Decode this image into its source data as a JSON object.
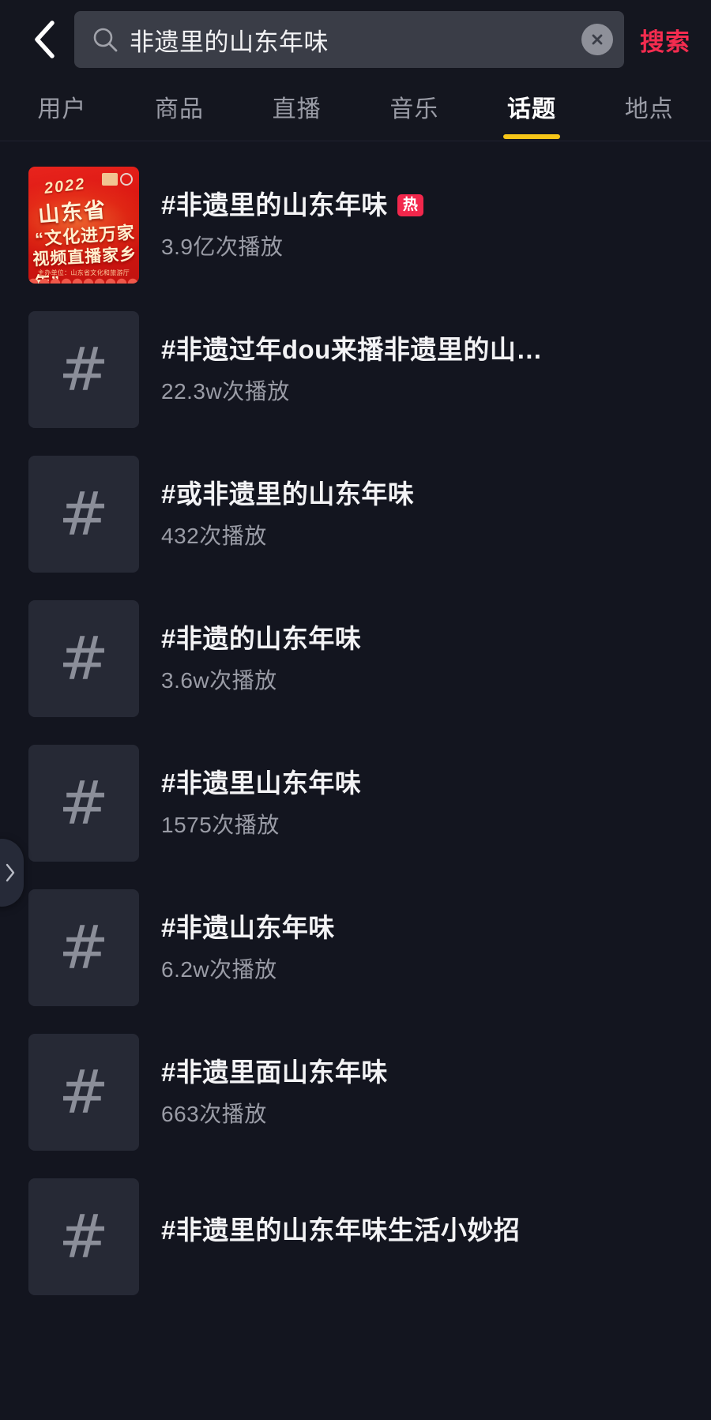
{
  "theme": {
    "background": "#13151f",
    "accent_red": "#f42c4f",
    "accent_yellow": "#f5c518",
    "badge_red": "#f2274c",
    "text_primary": "#f3f3f5",
    "text_secondary": "#9a9ca6",
    "thumb_bg": "#262935"
  },
  "header": {
    "back_icon": "chevron-left-icon",
    "search": {
      "icon": "search-icon",
      "value": "非遗里的山东年味",
      "placeholder": "搜索",
      "clear_icon": "close-circle-icon"
    },
    "submit_label": "搜索"
  },
  "tabs": {
    "active_index": 4,
    "items": [
      {
        "label": "用户"
      },
      {
        "label": "商品"
      },
      {
        "label": "直播"
      },
      {
        "label": "音乐"
      },
      {
        "label": "话题"
      },
      {
        "label": "地点"
      }
    ]
  },
  "poster": {
    "year": "2022",
    "line1": "山东省",
    "line2": "“文化进万家",
    "line3": "视频直播家乡年”",
    "footer": "主办单位：山东省文化和旅游厅"
  },
  "results": [
    {
      "thumb_type": "poster",
      "title": "#非遗里的山东年味",
      "badge": "热",
      "plays": "3.9亿次播放"
    },
    {
      "thumb_type": "hash",
      "thumb_glyph": "#",
      "title": "#非遗过年dou来播非遗里的山…",
      "badge": "",
      "plays": "22.3w次播放"
    },
    {
      "thumb_type": "hash",
      "thumb_glyph": "#",
      "title": "#或非遗里的山东年味",
      "badge": "",
      "plays": "432次播放"
    },
    {
      "thumb_type": "hash",
      "thumb_glyph": "#",
      "title": "#非遗的山东年味",
      "badge": "",
      "plays": "3.6w次播放"
    },
    {
      "thumb_type": "hash",
      "thumb_glyph": "#",
      "title": "#非遗里山东年味",
      "badge": "",
      "plays": "1575次播放"
    },
    {
      "thumb_type": "hash",
      "thumb_glyph": "#",
      "title": "#非遗山东年味",
      "badge": "",
      "plays": "6.2w次播放"
    },
    {
      "thumb_type": "hash",
      "thumb_glyph": "#",
      "title": "#非遗里面山东年味",
      "badge": "",
      "plays": "663次播放"
    },
    {
      "thumb_type": "hash",
      "thumb_glyph": "#",
      "title": "#非遗里的山东年味生活小妙招",
      "badge": "",
      "plays": ""
    }
  ],
  "edge_handle": {
    "icon": "chevron-right-icon"
  }
}
